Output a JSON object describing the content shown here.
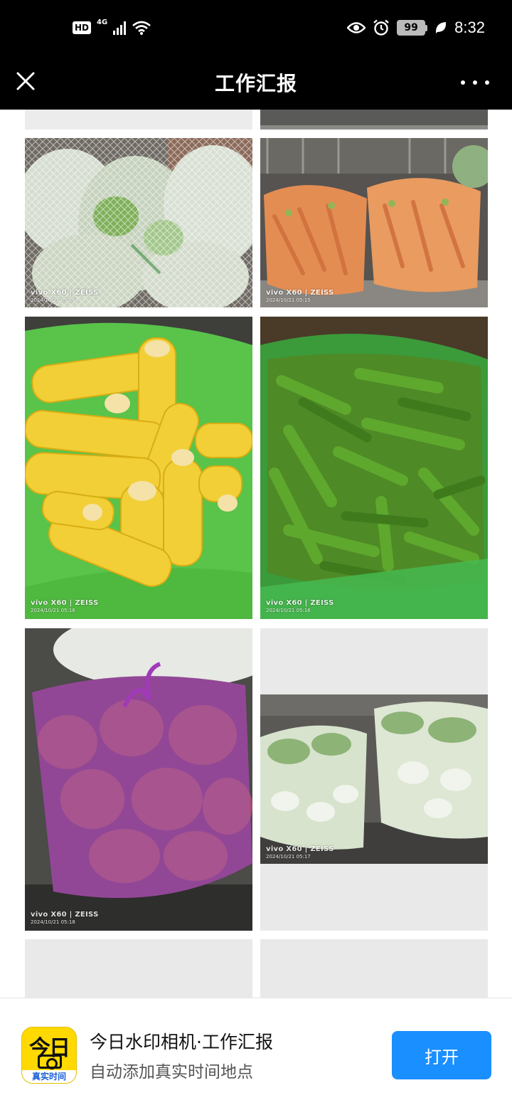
{
  "status_bar": {
    "hd_badge": "HD",
    "network": "4G",
    "battery": "99",
    "time": "8:32"
  },
  "header": {
    "title": "工作汇报"
  },
  "photos": [
    {
      "brand": "",
      "timestamp": "",
      "subject": "cabbage-bags",
      "colors": [
        "#e8ede4",
        "#9db88e"
      ]
    },
    {
      "brand": "vivo X60 | ZEISS",
      "timestamp": "2024/10/21 05:15",
      "subject": "cabbage-bags",
      "colors": [
        "#c9d6c2",
        "#7fa46b"
      ]
    },
    {
      "brand": "vivo X60 | ZEISS",
      "timestamp": "2024/10/21 05:15",
      "subject": "carrot-bags",
      "colors": [
        "#e07a35",
        "#c9c2b6"
      ]
    },
    {
      "brand": "vivo X60 | ZEISS",
      "timestamp": "2024/10/21 05:16",
      "subject": "corn-bag",
      "colors": [
        "#f2d23e",
        "#5cc24e"
      ]
    },
    {
      "brand": "vivo X60 | ZEISS",
      "timestamp": "2024/10/21 05:16",
      "subject": "green-peppers",
      "colors": [
        "#5a9a2c",
        "#2f6a17"
      ]
    },
    {
      "brand": "vivo X60 | ZEISS",
      "timestamp": "2024/10/21 05:18",
      "subject": "onion-bag",
      "colors": [
        "#8a3a78",
        "#b8608a"
      ]
    },
    {
      "brand": "vivo X60 | ZEISS",
      "timestamp": "2024/10/21 05:17",
      "subject": "napa-cabbage-bags",
      "colors": [
        "#d9e6cf",
        "#8db377"
      ]
    }
  ],
  "banner": {
    "app_icon_top": "今日",
    "app_icon_strip": "真实时间",
    "title": "今日水印相机·工作汇报",
    "subtitle": "自动添加真实时间地点",
    "open_button": "打开"
  },
  "colors": {
    "topbar_bg": "#000000",
    "open_button": "#1a8fff",
    "app_icon": "#ffd900",
    "placeholder": "#e9e9e9"
  }
}
